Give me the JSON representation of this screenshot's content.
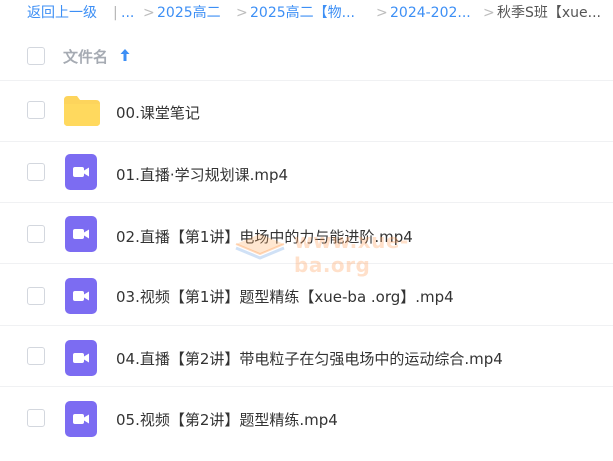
{
  "breadcrumb": {
    "back_label": "返回上一级",
    "divider": "|",
    "ellipsis": "...",
    "sep": ">",
    "items": [
      "2025高二",
      "2025高二【物...",
      "2024-202...",
      "秋季S班【xue..."
    ]
  },
  "list_header": {
    "column_label": "文件名"
  },
  "files": [
    {
      "name": "00.课堂笔记",
      "type": "folder",
      "icon": "folder-icon"
    },
    {
      "name": "01.直播·学习规划课.mp4",
      "type": "video",
      "icon": "video-file-icon"
    },
    {
      "name": "02.直播【第1讲】电场中的力与能进阶.mp4",
      "type": "video",
      "icon": "video-file-icon"
    },
    {
      "name": "03.视频【第1讲】题型精练【xue-ba .org】.mp4",
      "type": "video",
      "icon": "video-file-icon"
    },
    {
      "name": "04.直播【第2讲】带电粒子在匀强电场中的运动综合.mp4",
      "type": "video",
      "icon": "video-file-icon"
    },
    {
      "name": "05.视频【第2讲】题型精练.mp4",
      "type": "video",
      "icon": "video-file-icon"
    }
  ],
  "watermark": {
    "text": "www.xue-ba.org"
  },
  "colors": {
    "link": "#3d8ff5",
    "folder": "#fdd45c",
    "video": "#7c6cf2",
    "checkbox_border": "#d3d7de"
  }
}
